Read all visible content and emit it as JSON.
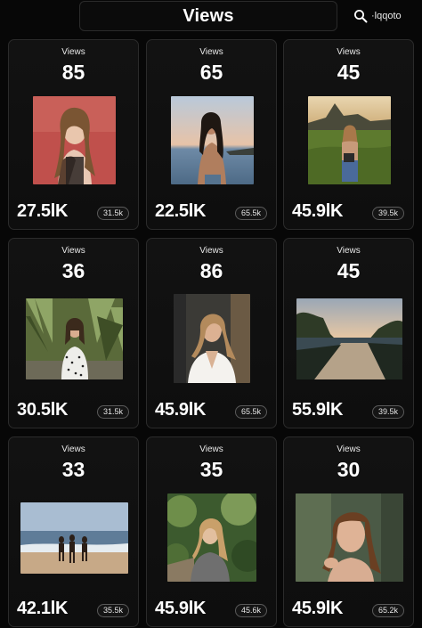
{
  "header": {
    "title": "Views",
    "search_label": "·lqqoto"
  },
  "cards": [
    {
      "label": "Views",
      "count": "85",
      "total": "27.5lK",
      "pill": "31.5k",
      "photo": "woman-red-wall"
    },
    {
      "label": "Views",
      "count": "65",
      "total": "22.5lK",
      "pill": "65.5k",
      "photo": "woman-beach-sunset"
    },
    {
      "label": "Views",
      "count": "45",
      "total": "45.9lK",
      "pill": "39.5k",
      "photo": "woman-hills"
    },
    {
      "label": "Views",
      "count": "36",
      "total": "30.5lK",
      "pill": "31.5k",
      "photo": "woman-polka-dress"
    },
    {
      "label": "Views",
      "count": "86",
      "total": "45.9lK",
      "pill": "65.5k",
      "photo": "woman-white-top"
    },
    {
      "label": "Views",
      "count": "45",
      "total": "55.9lK",
      "pill": "39.5k",
      "photo": "canal-sunset"
    },
    {
      "label": "Views",
      "count": "33",
      "total": "42.1lK",
      "pill": "35.5k",
      "photo": "beach-group"
    },
    {
      "label": "Views",
      "count": "35",
      "total": "45.9lK",
      "pill": "45.6k",
      "photo": "woman-garden"
    },
    {
      "label": "Views",
      "count": "30",
      "total": "45.9lK",
      "pill": "65.2k",
      "photo": "woman-bangs"
    }
  ]
}
